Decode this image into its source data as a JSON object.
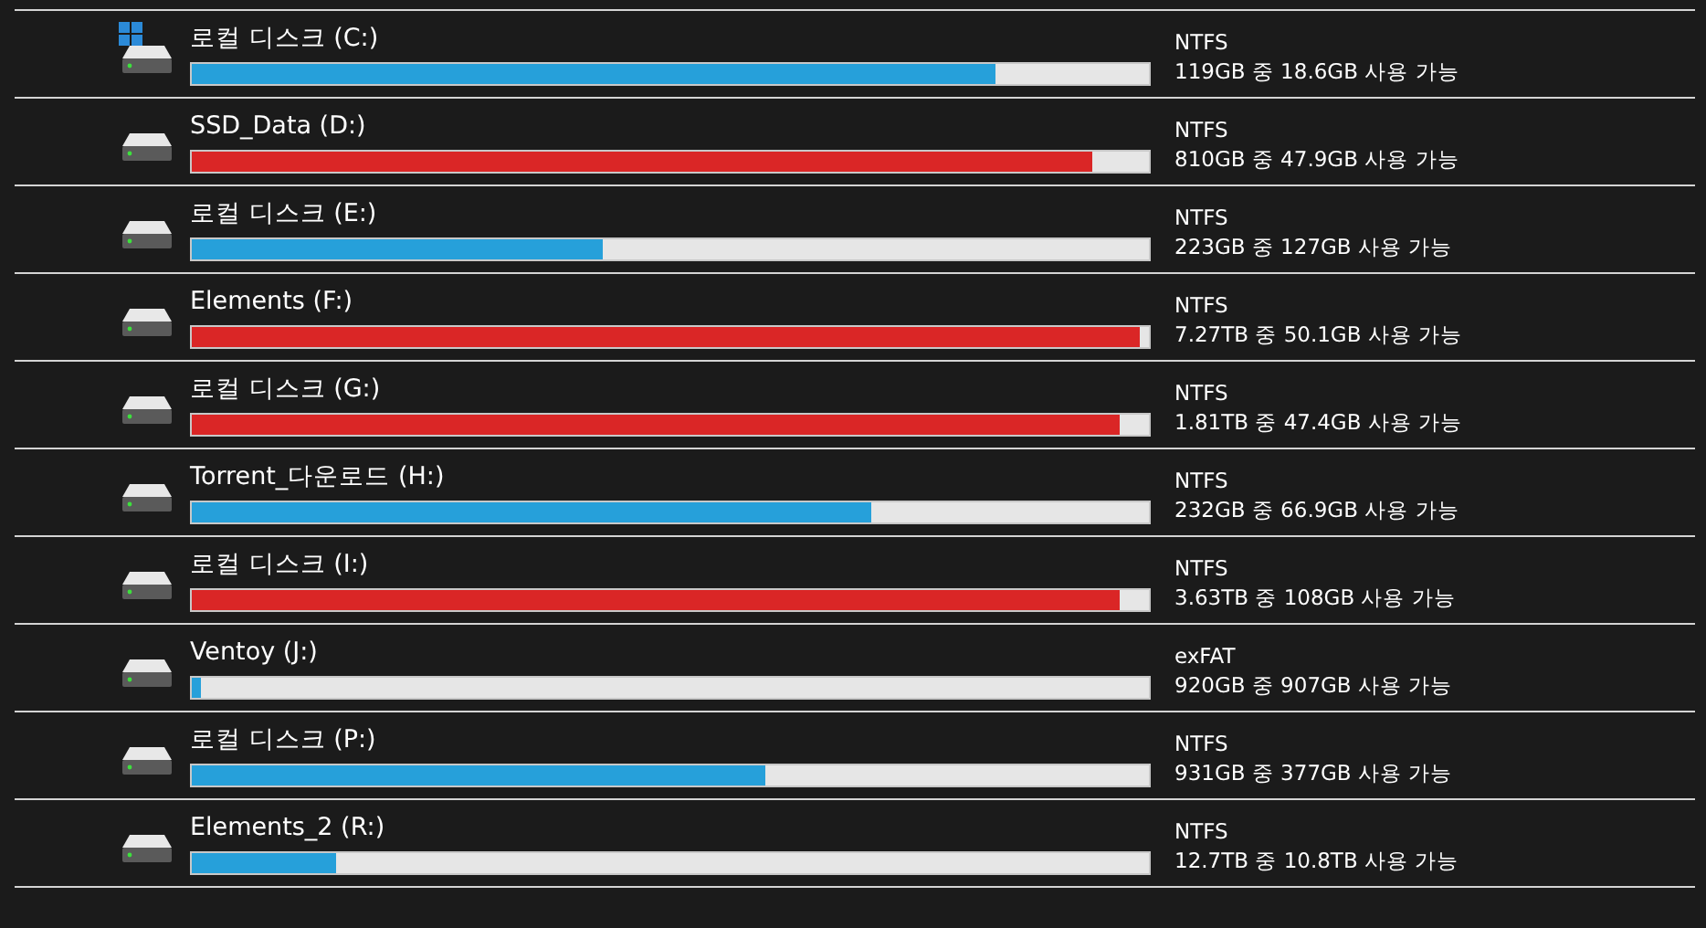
{
  "drives": [
    {
      "name": "로컬 디스크 (C:)",
      "system": true,
      "low_space": false,
      "level": 0.84,
      "filesystem": "NTFS",
      "space": "119GB 중 18.6GB 사용 가능"
    },
    {
      "name": "SSD_Data (D:)",
      "system": false,
      "low_space": true,
      "level": 0.94,
      "filesystem": "NTFS",
      "space": "810GB 중 47.9GB 사용 가능"
    },
    {
      "name": "로컬 디스크 (E:)",
      "system": false,
      "low_space": false,
      "level": 0.43,
      "filesystem": "NTFS",
      "space": "223GB 중 127GB 사용 가능"
    },
    {
      "name": "Elements (F:)",
      "system": false,
      "low_space": true,
      "level": 0.99,
      "filesystem": "NTFS",
      "space": "7.27TB 중 50.1GB 사용 가능"
    },
    {
      "name": "로컬 디스크 (G:)",
      "system": false,
      "low_space": true,
      "level": 0.97,
      "filesystem": "NTFS",
      "space": "1.81TB 중 47.4GB 사용 가능"
    },
    {
      "name": "Torrent_다운로드 (H:)",
      "system": false,
      "low_space": false,
      "level": 0.71,
      "filesystem": "NTFS",
      "space": "232GB 중 66.9GB 사용 가능"
    },
    {
      "name": "로컬 디스크 (I:)",
      "system": false,
      "low_space": true,
      "level": 0.97,
      "filesystem": "NTFS",
      "space": "3.63TB 중 108GB 사용 가능"
    },
    {
      "name": "Ventoy (J:)",
      "system": false,
      "low_space": false,
      "level": 0.01,
      "filesystem": "exFAT",
      "space": "920GB 중 907GB 사용 가능"
    },
    {
      "name": "로컬 디스크 (P:)",
      "system": false,
      "low_space": false,
      "level": 0.6,
      "filesystem": "NTFS",
      "space": "931GB 중 377GB 사용 가능"
    },
    {
      "name": "Elements_2 (R:)",
      "system": false,
      "low_space": false,
      "level": 0.15,
      "filesystem": "NTFS",
      "space": "12.7TB 중 10.8TB 사용 가능"
    }
  ]
}
